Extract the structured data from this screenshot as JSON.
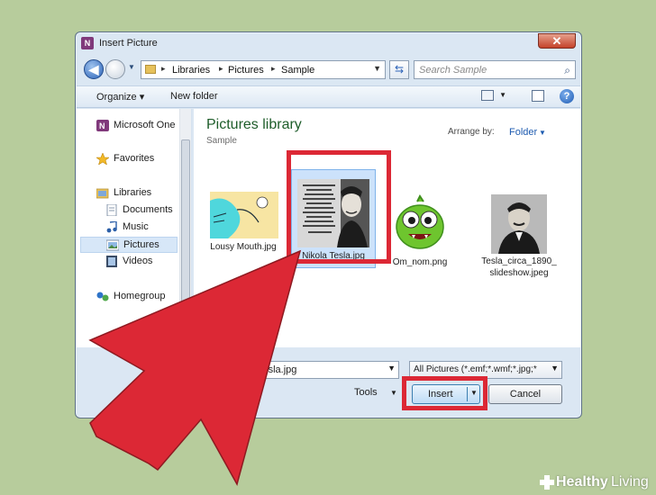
{
  "window": {
    "title": "Insert Picture",
    "app_icon_letter": "N",
    "close_symbol": "✕"
  },
  "navbar": {
    "back_symbol": "◀",
    "breadcrumbs": [
      "Libraries",
      "Pictures",
      "Sample"
    ],
    "separator": "▸",
    "refresh_symbol": "⇆",
    "search_placeholder": "Search Sample",
    "search_symbol": "⌕",
    "dropdown_symbol": "▼"
  },
  "toolbar": {
    "organize_label": "Organize ▾",
    "new_folder_label": "New folder",
    "help_symbol": "?"
  },
  "nav_pane": {
    "items": [
      {
        "label": "Microsoft One",
        "icon": "onenote-icon",
        "sub": false
      },
      {
        "label": "Favorites",
        "icon": "star-icon",
        "sub": false
      },
      {
        "label": "Libraries",
        "icon": "libraries-icon",
        "sub": false
      },
      {
        "label": "Documents",
        "icon": "documents-icon",
        "sub": true
      },
      {
        "label": "Music",
        "icon": "music-icon",
        "sub": true
      },
      {
        "label": "Pictures",
        "icon": "pictures-icon",
        "sub": true,
        "selected": true
      },
      {
        "label": "Videos",
        "icon": "videos-icon",
        "sub": true
      },
      {
        "label": "Homegroup",
        "icon": "homegroup-icon",
        "sub": false
      }
    ]
  },
  "content": {
    "library_title": "Pictures library",
    "library_subtitle": "Sample",
    "arrange_label": "Arrange by:",
    "arrange_value": "Folder",
    "files": [
      {
        "name": "Lousy Mouth.jpg"
      },
      {
        "name": "Nikola Tesla.jpg",
        "selected": true,
        "quote": "\"Every living being is an engine geared to the wheelwork of the universe. Though seemingly affected only by its immediate surrounding, the sphere of external influence extends to infinite distance.\" - Nikola Tesla"
      },
      {
        "name": "Om_nom.png"
      },
      {
        "name_line1": "Tesla_circa_1890_",
        "name_line2": "slideshow.jpeg"
      }
    ]
  },
  "footer": {
    "file_name_value": "Tesla.jpg",
    "file_type_value": "All Pictures (*.emf;*.wmf;*.jpg;*",
    "tools_label": "Tools",
    "insert_label": "Insert",
    "cancel_label": "Cancel"
  },
  "annotations": {
    "highlight_color": "#dc2835",
    "arrow_color": "#dc2835"
  },
  "brand": {
    "part1": "Healthy",
    "part2": "Living"
  }
}
